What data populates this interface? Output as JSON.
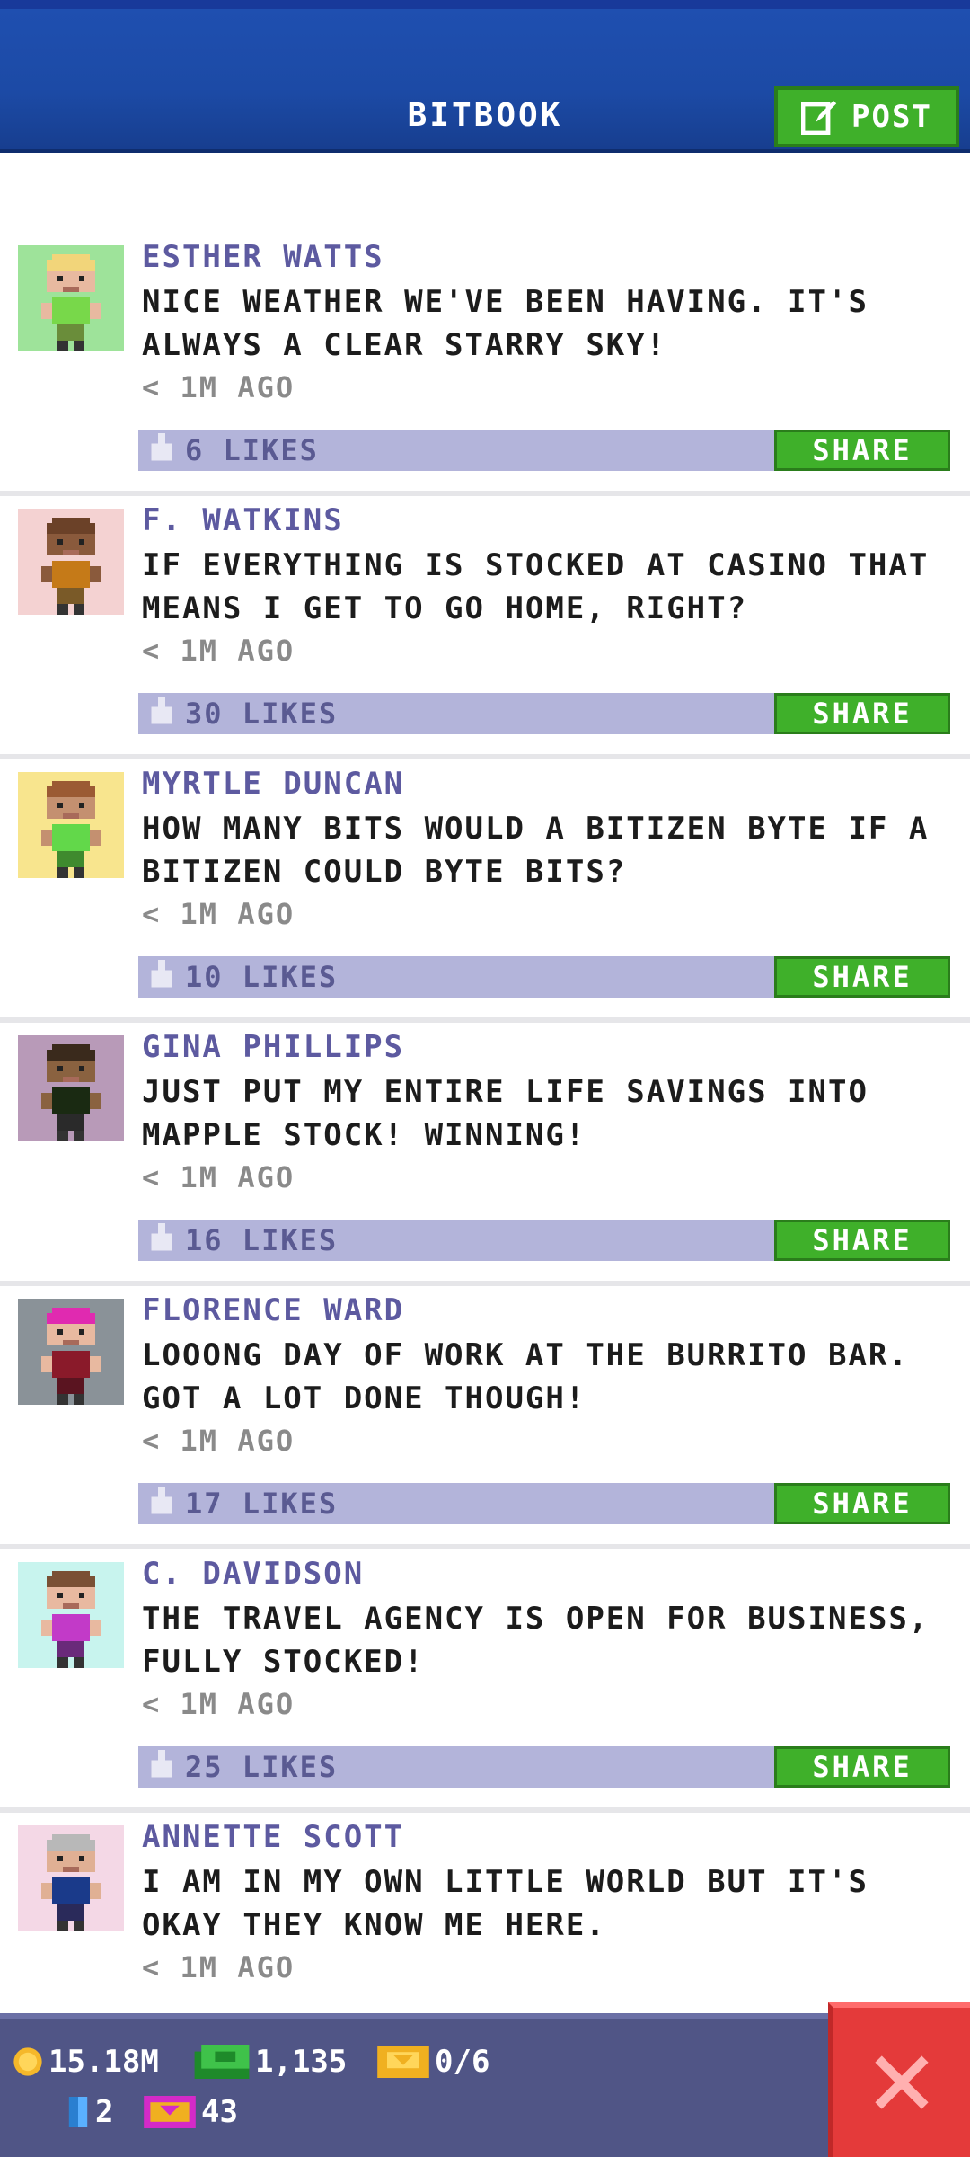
{
  "header": {
    "title": "BITBOOK",
    "post_label": "POST"
  },
  "posts": [
    {
      "name": "ESTHER WATTS",
      "text": "NICE WEATHER WE'VE BEEN HAVING. IT'S ALWAYS A CLEAR STARRY SKY!",
      "time": "< 1M AGO",
      "likes": "6 LIKES",
      "share": "SHARE",
      "avatar_bg": "#9ee39a",
      "skin": "#e8b9a0",
      "hair": "#f2d57a",
      "shirt": "#78d84a",
      "pants": "#6a8d3a"
    },
    {
      "name": "F. WATKINS",
      "text": "IF EVERYTHING IS STOCKED AT CASINO THAT MEANS I GET TO GO HOME, RIGHT?",
      "time": "< 1M AGO",
      "likes": "30 LIKES",
      "share": "SHARE",
      "avatar_bg": "#f4d2d2",
      "skin": "#8a5a3c",
      "hair": "#6b4128",
      "shirt": "#c57a18",
      "pants": "#7a5a28"
    },
    {
      "name": "MYRTLE DUNCAN",
      "text": "HOW MANY BITS WOULD A BITIZEN BYTE IF A BITIZEN COULD BYTE BITS?",
      "time": "< 1M AGO",
      "likes": "10 LIKES",
      "share": "SHARE",
      "avatar_bg": "#f8e58e",
      "skin": "#c49070",
      "hair": "#9b5a34",
      "shirt": "#62d84a",
      "pants": "#3f8a2e"
    },
    {
      "name": "GINA PHILLIPS",
      "text": "JUST PUT MY ENTIRE LIFE SAVINGS INTO MAPPLE STOCK! WINNING!",
      "time": "< 1M AGO",
      "likes": "16 LIKES",
      "share": "SHARE",
      "avatar_bg": "#b89ab8",
      "skin": "#8a6240",
      "hair": "#3a2a1c",
      "shirt": "#1a2a12",
      "pants": "#2a2a2a"
    },
    {
      "name": "FLORENCE WARD",
      "text": "LOOONG DAY OF WORK AT THE BURRITO BAR. GOT A LOT DONE THOUGH!",
      "time": "< 1M AGO",
      "likes": "17 LIKES",
      "share": "SHARE",
      "avatar_bg": "#8a9298",
      "skin": "#e8b9a0",
      "hair": "#e02ab0",
      "shirt": "#8a1a2a",
      "pants": "#5a1420"
    },
    {
      "name": "C. DAVIDSON",
      "text": "THE TRAVEL AGENCY IS OPEN FOR BUSINESS, FULLY STOCKED!",
      "time": "< 1M AGO",
      "likes": "25 LIKES",
      "share": "SHARE",
      "avatar_bg": "#c8f4ee",
      "skin": "#e8b9a0",
      "hair": "#7a5034",
      "shirt": "#c23ac8",
      "pants": "#6a2a7a"
    },
    {
      "name": "ANNETTE SCOTT",
      "text": "I AM IN MY OWN LITTLE WORLD BUT IT'S OKAY THEY KNOW ME HERE.",
      "time": "< 1M AGO",
      "likes": "",
      "share": "",
      "avatar_bg": "#f4d8e6",
      "skin": "#e0b094",
      "hair": "#b8b8b8",
      "shirt": "#1a3a8a",
      "pants": "#2a2a5a"
    }
  ],
  "status": {
    "coins": "15.18M",
    "bux": "1,135",
    "tickets": "0/6",
    "elevators": "2",
    "vip": "43"
  },
  "colors": {
    "accent_green": "#3fb02a",
    "header_blue": "#1f4fb0",
    "close_red": "#e43a3a",
    "likes_bar": "#b3b4da"
  }
}
